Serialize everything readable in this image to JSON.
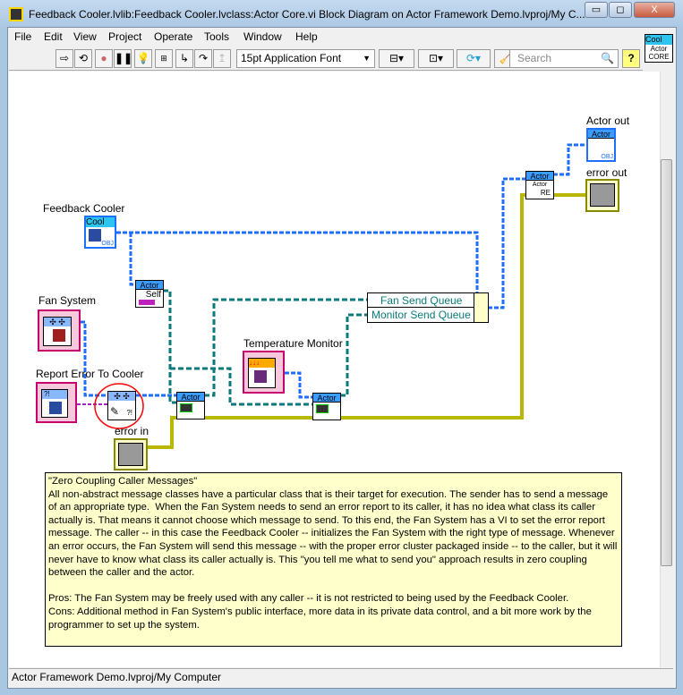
{
  "window": {
    "title": "Feedback Cooler.lvlib:Feedback Cooler.lvclass:Actor Core.vi Block Diagram on Actor Framework Demo.lvproj/My C...",
    "minimize": "▭",
    "maximize": "◻",
    "close": "X"
  },
  "menu": [
    "File",
    "Edit",
    "View",
    "Project",
    "Operate",
    "Tools",
    "Window",
    "Help"
  ],
  "toolbar": {
    "font_select": "15pt Application Font",
    "search_placeholder": "Search",
    "help": "?"
  },
  "vi_icon": {
    "top": "Cool",
    "line1": "Actor",
    "line2": "CORE"
  },
  "diagram": {
    "feedback_cooler": {
      "label": "Feedback Cooler",
      "header": "Cool",
      "tag": "OBJ"
    },
    "fan_system": {
      "label": "Fan System"
    },
    "report_error": {
      "label": "Report Error To Cooler",
      "tag": "?!"
    },
    "set_msg": {
      "tag": "?!"
    },
    "self_node": {
      "header": "Actor",
      "text": "Self"
    },
    "launch1": {
      "header": "Actor"
    },
    "launch2": {
      "header": "Actor"
    },
    "temperature_monitor": {
      "label": "Temperature Monitor"
    },
    "bundle": {
      "fields": [
        "Fan Send Queue",
        "Monitor Send Queue"
      ]
    },
    "actor_core_node": {
      "header": "Actor",
      "text": "Actor",
      "sub": "RE"
    },
    "actor_out": {
      "label": "Actor out",
      "header": "Actor",
      "tag": "OBJ"
    },
    "error_out": {
      "label": "error out"
    },
    "error_in": {
      "label": "error in"
    },
    "comment": "\"Zero Coupling Caller Messages\"\nAll non-abstract message classes have a particular class that is their target for execution. The sender has to send a message of an appropriate type.  When the Fan System needs to send an error report to its caller, it has no idea what class its caller actually is. That means it cannot choose which message to send. To this end, the Fan System has a VI to set the error report message. The caller -- in this case the Feedback Cooler -- initializes the Fan System with the right type of message. Whenever an error occurs, the Fan System will send this message -- with the proper error cluster packaged inside -- to the caller, but it will never have to know what class its caller actually is. This \"you tell me what to send you\" approach results in zero coupling between the caller and the actor.\n\nPros: The Fan System may be freely used with any caller -- it is not restricted to being used by the Feedback Cooler.\nCons: Additional method in Fan System's public interface, more data in its private data control, and a bit more work by the programmer to set up the system."
  },
  "status": "Actor Framework Demo.lvproj/My Computer",
  "colors": {
    "class_wire": "#1e6fff",
    "actor_wire": "#0a7a7a",
    "msg_wire": "#a020c0",
    "error_wire": "#b8b800",
    "annotation": "#ff0000"
  }
}
